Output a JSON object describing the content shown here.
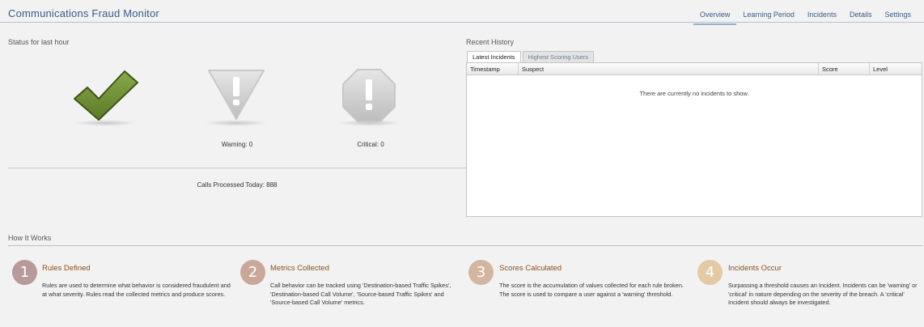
{
  "header": {
    "title": "Communications Fraud Monitor",
    "nav": [
      {
        "label": "Overview",
        "active": true
      },
      {
        "label": "Learning Period",
        "active": false
      },
      {
        "label": "Incidents",
        "active": false
      },
      {
        "label": "Details",
        "active": false
      },
      {
        "label": "Settings",
        "active": false
      }
    ]
  },
  "status": {
    "label": "Status for last hour",
    "warning_label": "Warning: 0",
    "critical_label": "Critical: 0",
    "calls_processed": "Calls Processed Today: 888"
  },
  "recent_history": {
    "label": "Recent History",
    "tabs": [
      {
        "label": "Latest Incidents",
        "active": true
      },
      {
        "label": "Highest Scoring Users",
        "active": false
      }
    ],
    "columns": [
      "Timestamp",
      "Suspect",
      "Score",
      "Level"
    ],
    "empty_message": "There are currently no incidents to show."
  },
  "how_it_works": {
    "label": "How It Works",
    "steps": [
      {
        "num": "1",
        "title": "Rules Defined",
        "color": "#b89a9a",
        "text": "Rules are used to determine what behavior is considered fraudulent and at what severity. Rules read the collected metrics and produce scores."
      },
      {
        "num": "2",
        "title": "Metrics Collected",
        "color": "#c9a89a",
        "text": "Call behavior can be tracked using 'Destination-based Traffic Spikes', 'Destination-based Call Volume', 'Source-based Traffic Spikes' and 'Source-based Call Volume' metrics."
      },
      {
        "num": "3",
        "title": "Scores Calculated",
        "color": "#d3b6a0",
        "text": "The score is the accumulation of values collected for each rule broken. The score is used to compare a user against a 'warning' threshold."
      },
      {
        "num": "4",
        "title": "Incidents Occur",
        "color": "#e3c9a4",
        "text": "Surpassing a threshold causes an Incident. Incidents can be 'warning' or 'critical' in nature depending on the severity of the breach. A 'critical' Incident should always be investigated."
      }
    ]
  },
  "colors": {
    "check_green": "#6f8f36",
    "title_blue": "#3d5a87",
    "step_title": "#8a4f1e"
  }
}
